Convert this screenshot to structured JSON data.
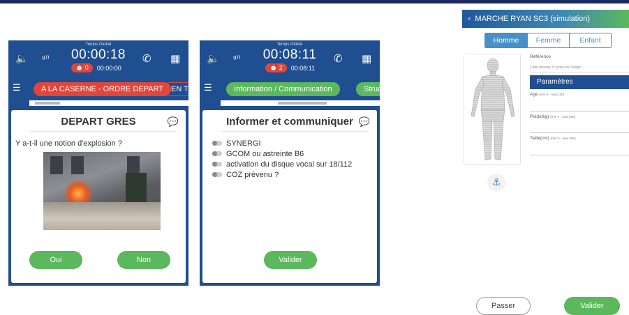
{
  "panel1": {
    "timer_label": "Temps Global",
    "time": "00:00:18",
    "alarm_count": "0",
    "sub_time": "00:00:00",
    "tabs": [
      "A LA CASERNE - ORDRE DEPART",
      "EN TR"
    ],
    "card_title": "DEPART GRES",
    "question": "Y a-t-il une notion d'explosion ?",
    "btn_yes": "Oui",
    "btn_no": "Non"
  },
  "panel2": {
    "timer_label": "Temps Global",
    "time": "00:08:11",
    "alarm_count": "2",
    "sub_time": "00:08:11",
    "tabs": [
      "Information / Communication",
      "Struc"
    ],
    "card_title": "Informer et communiquer",
    "items": [
      "SYNERGI",
      "GCOM ou astreinte B6",
      "activation du disque vocal sur 18/112",
      "COZ prévenu ?"
    ],
    "btn_validate": "Valider"
  },
  "right": {
    "title": "MARCHE RYAN SC3 (simulation)",
    "segments": [
      "Homme",
      "Femme",
      "Enfant"
    ],
    "reference_label": "Référence",
    "reference_placeholder": "Code dossier, n° prise en charge...",
    "params_title": "Paramètres",
    "age_label": "Age",
    "age_hint": "(min 0 - max 130)",
    "weight_label": "Poids(kg)",
    "weight_hint": "(min 0 - max 600)",
    "height_label": "Taille(cm)",
    "height_hint": "(min 0 - max 250)"
  },
  "footer": {
    "skip": "Passer",
    "validate": "Valider"
  },
  "colors": {
    "header_blue": "#1f4e91",
    "accent_red": "#e2453a",
    "accent_green": "#5cb85c",
    "segment_blue": "#4a90c8"
  }
}
